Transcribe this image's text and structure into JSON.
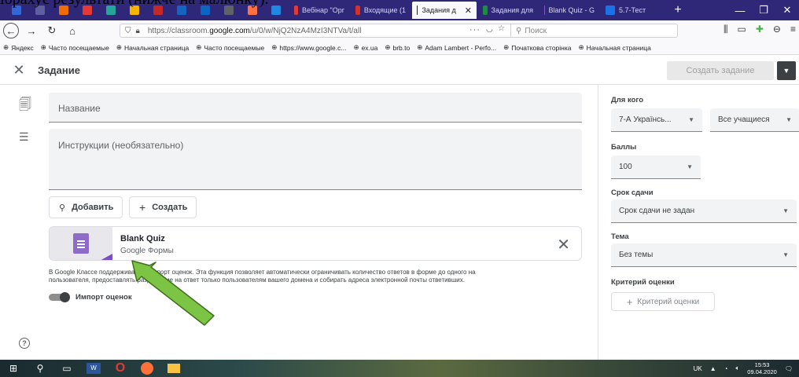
{
  "doc_snippet": "ібрахує результати (нижче на малюнку).",
  "browser": {
    "tabs": [
      {
        "label": "Вебінар \"Орг",
        "fav_color": "#e53935"
      },
      {
        "label": "Входящие (1",
        "fav_color": "#d93025"
      },
      {
        "label": "Задания д",
        "fav_color": "#202124",
        "active": true
      },
      {
        "label": "Задания для",
        "fav_color": "#1e8e3e"
      },
      {
        "label": "Blank Quiz - G",
        "fav_color": "#7e57c2"
      },
      {
        "label": "5.7-Тест",
        "fav_color": "#1a73e8"
      }
    ],
    "mini_tab_colors": [
      "#3367d6",
      "#5f5fa0",
      "#ef6c00",
      "#e53935",
      "#26a69a",
      "#f4b400",
      "#c62828",
      "#1565c0",
      "#0a66c2",
      "#5f6368",
      "#ff7043",
      "#1e88e5"
    ],
    "url_prefix": "https://classroom.",
    "url_domain": "google.com",
    "url_suffix": "/u/0/w/NjQ2NzA4MzI3NTVa/t/all",
    "search_placeholder": "Поиск",
    "bookmarks": [
      "Яндекс",
      "Часто посещаемые",
      "Начальная страница",
      "Часто посещаемые",
      "https://www.google.c...",
      "ex.ua",
      "brb.to",
      "Adam Lambert - Perfo...",
      "Початкова сторінка",
      "Начальная страница"
    ]
  },
  "app": {
    "header_title": "Задание",
    "create_label": "Создать задание",
    "title_field": "Название",
    "instructions_field": "Инструкции (необязательно)",
    "add_label": "Добавить",
    "create_new_label": "Создать",
    "attachment": {
      "title": "Blank Quiz",
      "subtitle": "Google Формы"
    },
    "info_line1": "В Google Классе поддерживается импорт оценок. Эта функция позволяет автоматически ограничивать количество ответов в форме до одного на",
    "info_line2": "пользователя, предоставлять разрешение на ответ только пользователям вашего домена и собирать адреса электронной почты ответивших.",
    "toggle_label": "Импорт оценок",
    "toggle_on": true
  },
  "panel": {
    "for_whom_label": "Для кого",
    "class_value": "7-А Українсь...",
    "students_value": "Все учащиеся",
    "points_label": "Баллы",
    "points_value": "100",
    "due_label": "Срок сдачи",
    "due_value": "Срок сдачи не задан",
    "topic_label": "Тема",
    "topic_value": "Без темы",
    "rubric_label": "Критерий оценки",
    "rubric_button": "Критерий оценки"
  },
  "taskbar": {
    "lang": "UK",
    "time": "15:53",
    "date": "09.04.2020"
  }
}
